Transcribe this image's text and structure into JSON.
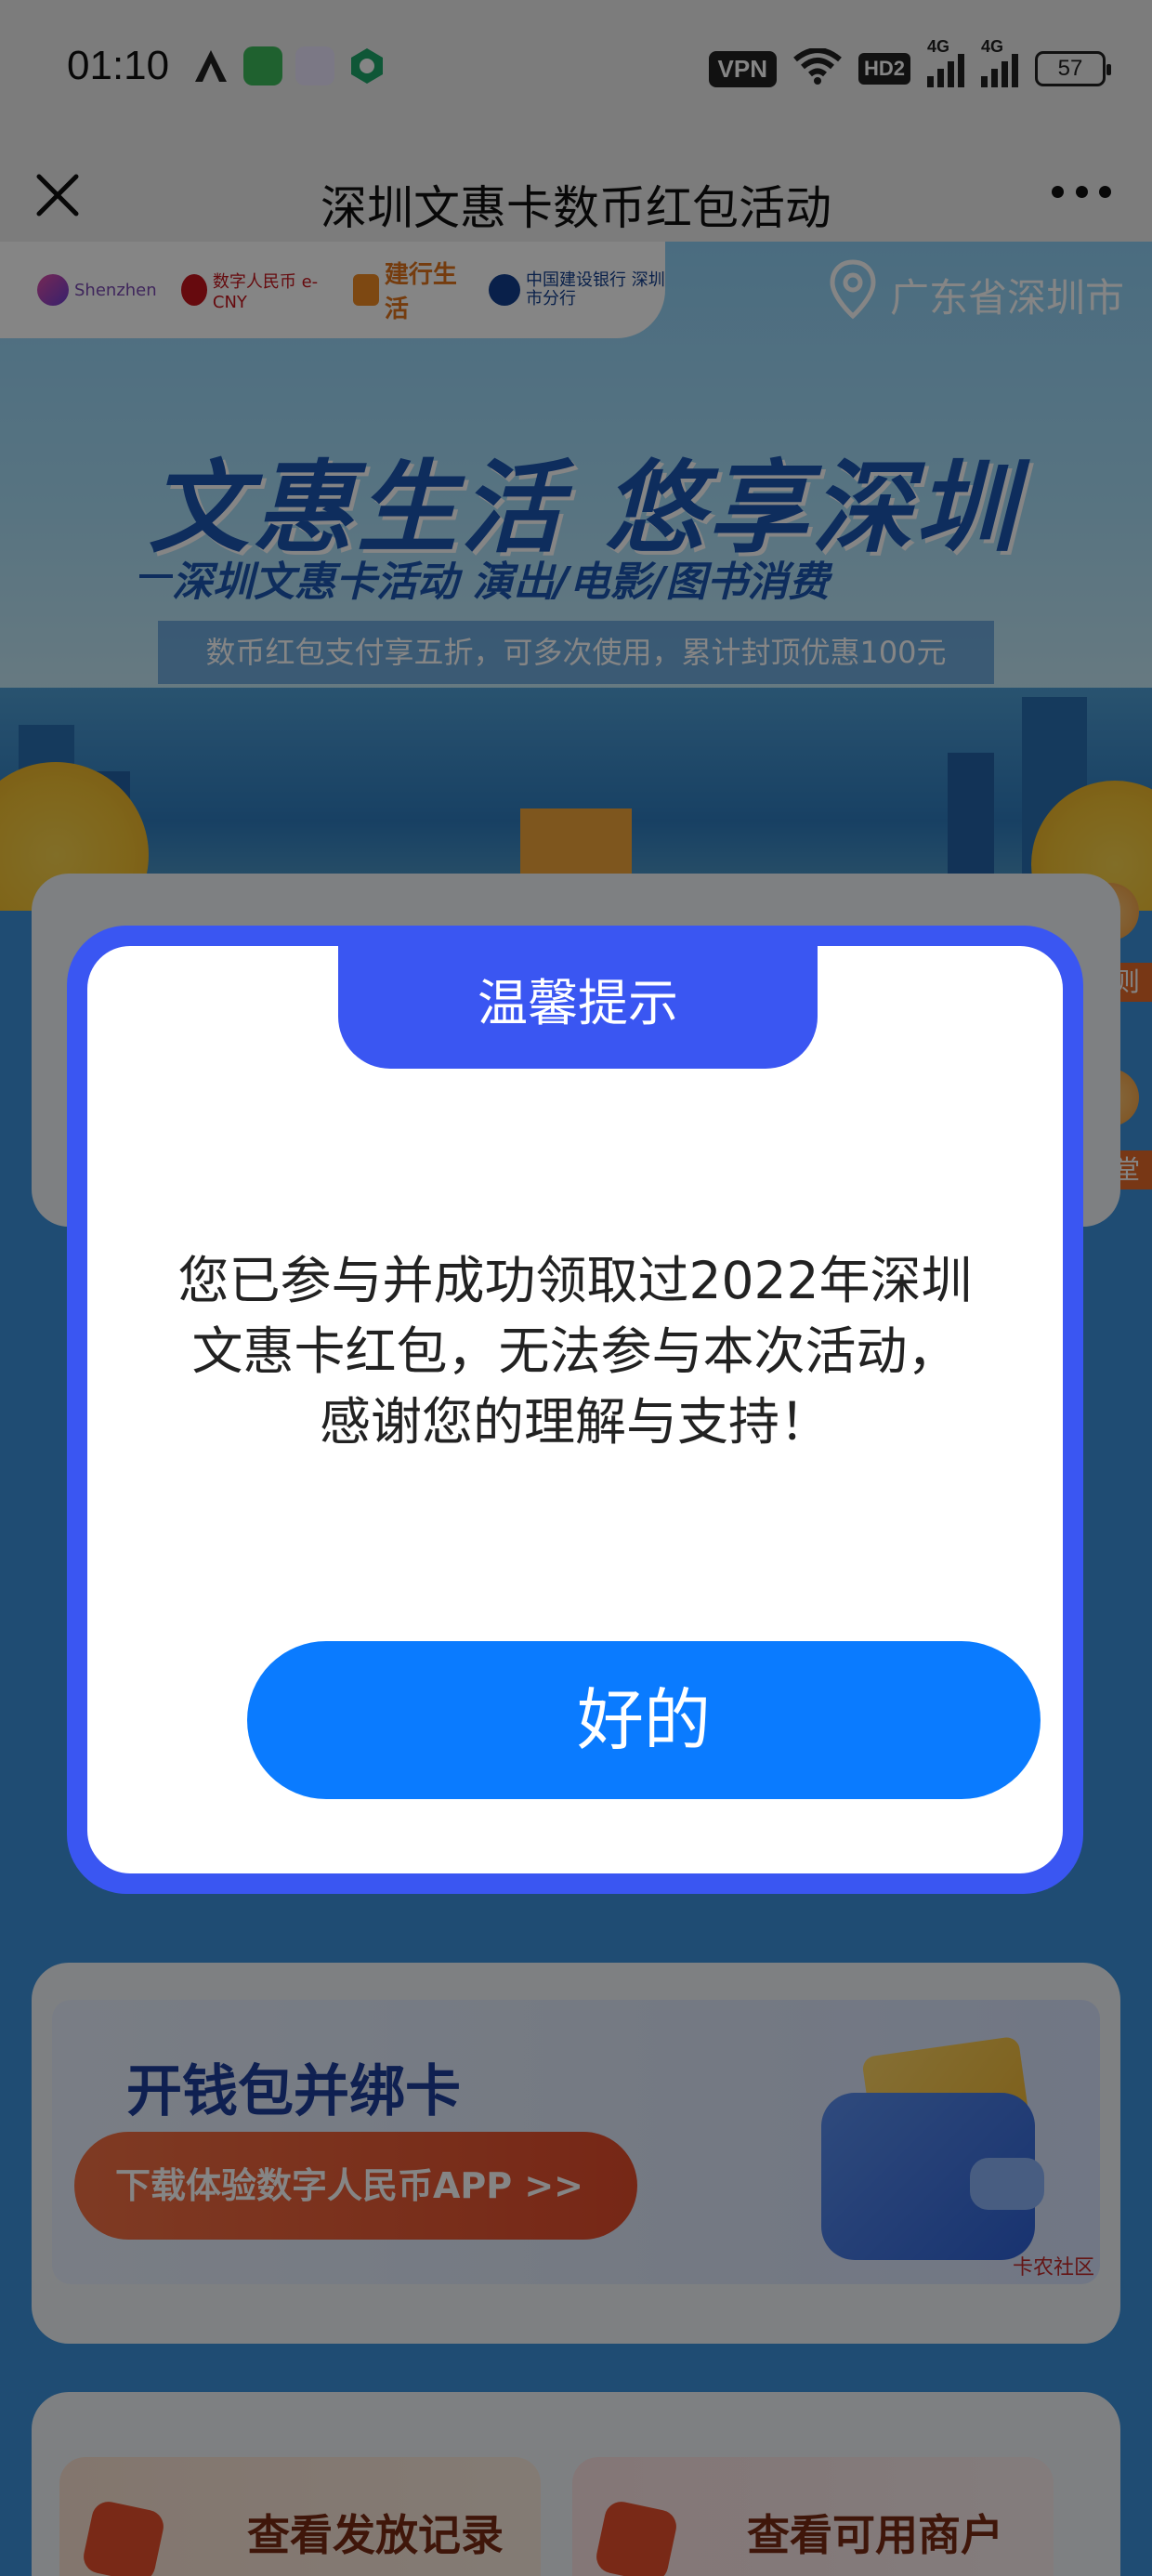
{
  "status_bar": {
    "time": "01:10",
    "vpn": "VPN",
    "hd": "HD2",
    "network_1": "4G",
    "network_2": "4G",
    "battery": "57",
    "app_icon_colors": [
      "#222222",
      "#3dbb5a",
      "#7d6cf0",
      "#1ea86a"
    ]
  },
  "nav": {
    "title": "深圳文惠卡数币红包活动",
    "close_icon": "close-icon",
    "more_icon": "more-dots-icon"
  },
  "banner": {
    "logos": [
      "Shenzhen",
      "数字人民币 e-CNY",
      "建行生活",
      "中国建设银行 深圳市分行"
    ],
    "location": "广东省深圳市",
    "slogan": "文惠生活  悠享深圳",
    "sub_slogan": "深圳文惠卡活动  演出/电影/图书消费",
    "ribbon": "数币红包支付享五折，可多次使用，累计封顶优惠100元"
  },
  "side_tabs": [
    "规则",
    "课堂"
  ],
  "wallet_card": {
    "title": "开钱包并绑卡",
    "button": "下载体验数字人民币APP  >>"
  },
  "bottom_card": {
    "left": "查看发放记录",
    "right": "查看可用商户"
  },
  "watermark": "卡农社区",
  "dialog": {
    "title": "温馨提示",
    "message": "您已参与并成功领取过2022年深圳文惠卡红包，无法参与本次活动，感谢您的理解与支持！",
    "ok_button": "好的"
  },
  "colors": {
    "dialog_border": "#3a56f2",
    "ok_button": "#0a7bff",
    "nav_bg": "#ededed"
  }
}
